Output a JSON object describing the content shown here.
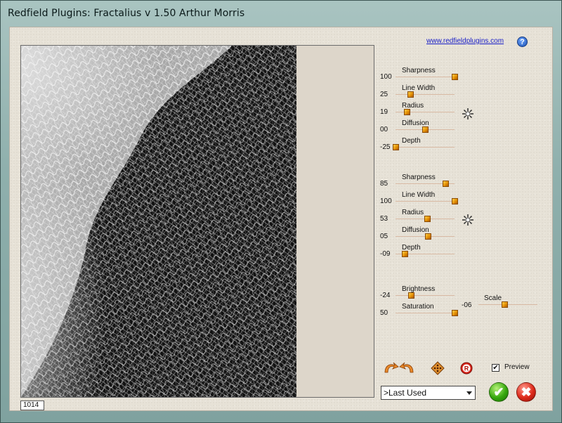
{
  "window": {
    "title": "Redfield Plugins: Fractalius v 1.50   Arthur Morris"
  },
  "header": {
    "link_text": "www.redfieldplugins.com",
    "help_icon": "?"
  },
  "status": {
    "value": "1014"
  },
  "group1": {
    "sliders": [
      {
        "label": "Sharpness",
        "value": "100",
        "level": 1.0
      },
      {
        "label": "Line Width",
        "value": "25",
        "level": 0.25
      },
      {
        "label": "Radius",
        "value": "19",
        "level": 0.19
      },
      {
        "label": "Diffusion",
        "value": "00",
        "level": 0.5
      },
      {
        "label": "Depth",
        "value": "-25",
        "level": 0.0
      }
    ]
  },
  "group2": {
    "sliders": [
      {
        "label": "Sharpness",
        "value": "85",
        "level": 0.85
      },
      {
        "label": "Line Width",
        "value": "100",
        "level": 1.0
      },
      {
        "label": "Radius",
        "value": "53",
        "level": 0.53
      },
      {
        "label": "Diffusion",
        "value": "05",
        "level": 0.55
      },
      {
        "label": "Depth",
        "value": "-09",
        "level": 0.16
      }
    ]
  },
  "group3": {
    "sliders": [
      {
        "label": "Brightness",
        "value": "-24",
        "level": 0.26
      },
      {
        "label": "Saturation",
        "value": "50",
        "level": 1.0
      }
    ],
    "scale": {
      "label": "Scale",
      "value": "-06",
      "level": 0.44
    }
  },
  "icons": {
    "sparkle": "sparkle-icon",
    "undo_redo": "undo-redo-arrows-icon",
    "random": "dice-icon",
    "reset": "reset-r-icon",
    "ok": "checkmark-icon",
    "cancel": "x-icon"
  },
  "preview": {
    "label": "Preview",
    "checked": true,
    "check_mark": "✔"
  },
  "preset": {
    "selected": ">Last Used"
  },
  "buttons": {
    "ok_glyph": "✔",
    "cancel_glyph": "✖"
  },
  "colors": {
    "thumb": "#f0a000",
    "track": "#7a3a1a",
    "link": "#1c21c8"
  }
}
